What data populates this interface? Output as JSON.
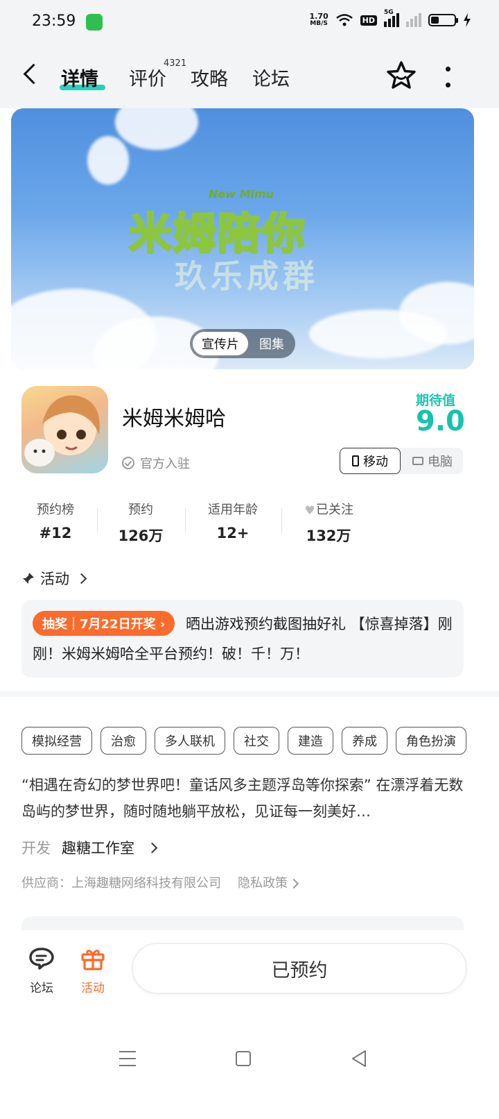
{
  "status_bar": {
    "time": "23:59",
    "net_speed_value": "1.70",
    "net_speed_unit": "MB/S",
    "hd_label": "HD",
    "signal_label": "5G",
    "battery_level": 0.35,
    "icons": [
      "app-notification-icon",
      "wifi-icon",
      "hd-icon",
      "signal-icon",
      "signal-icon-2",
      "battery-icon",
      "charging-icon"
    ]
  },
  "nav": {
    "tabs": [
      {
        "label": "详情",
        "active": true
      },
      {
        "label": "评价",
        "badge": "4321"
      },
      {
        "label": "攻略"
      },
      {
        "label": "论坛"
      }
    ],
    "icons": [
      "back-icon",
      "star-icon",
      "more-icon"
    ]
  },
  "banner": {
    "logo_text": "米姆陪你",
    "logo_tag": "New Mimu",
    "sub_text": "玖乐成群",
    "toggle": [
      "宣传片",
      "图集"
    ]
  },
  "app": {
    "name": "米姆米姆哈",
    "official": "官方入驻",
    "expect_label": "期待值",
    "expect_score": "9.0",
    "platforms": [
      "移动",
      "电脑"
    ]
  },
  "stats": [
    {
      "label": "预约榜",
      "value": "#12"
    },
    {
      "label": "预约",
      "value": "126万"
    },
    {
      "label": "适用年龄",
      "value": "12+"
    },
    {
      "label": "已关注",
      "value": "132万"
    }
  ],
  "activity": {
    "title": "活动",
    "tag": "抽奖｜7月22日开奖 ›",
    "text": "晒出游戏预约截图抽好礼 【惊喜掉落】刚刚！米姆米姆哈全平台预约！破！千！万！"
  },
  "tags": [
    "模拟经营",
    "治愈",
    "多人联机",
    "社交",
    "建造",
    "养成",
    "角色扮演"
  ],
  "description": "“相遇在奇幻的梦世界吧！童话风多主题浮岛等你探索” 在漂浮着无数岛屿的梦世界，随时随地躺平放松，见证每一刻美好…",
  "developer": {
    "label": "开发",
    "name": "趣糖工作室"
  },
  "supplier": {
    "text": "供应商：上海趣糖网络科技有限公司",
    "privacy": "隐私政策"
  },
  "bottom_bar": {
    "forum": "论坛",
    "activity": "活动",
    "reserve": "已预约"
  },
  "colors": {
    "accent": "#14c3b0",
    "orange": "#fb6b2b",
    "bg_gray": "#f4f5f7"
  }
}
